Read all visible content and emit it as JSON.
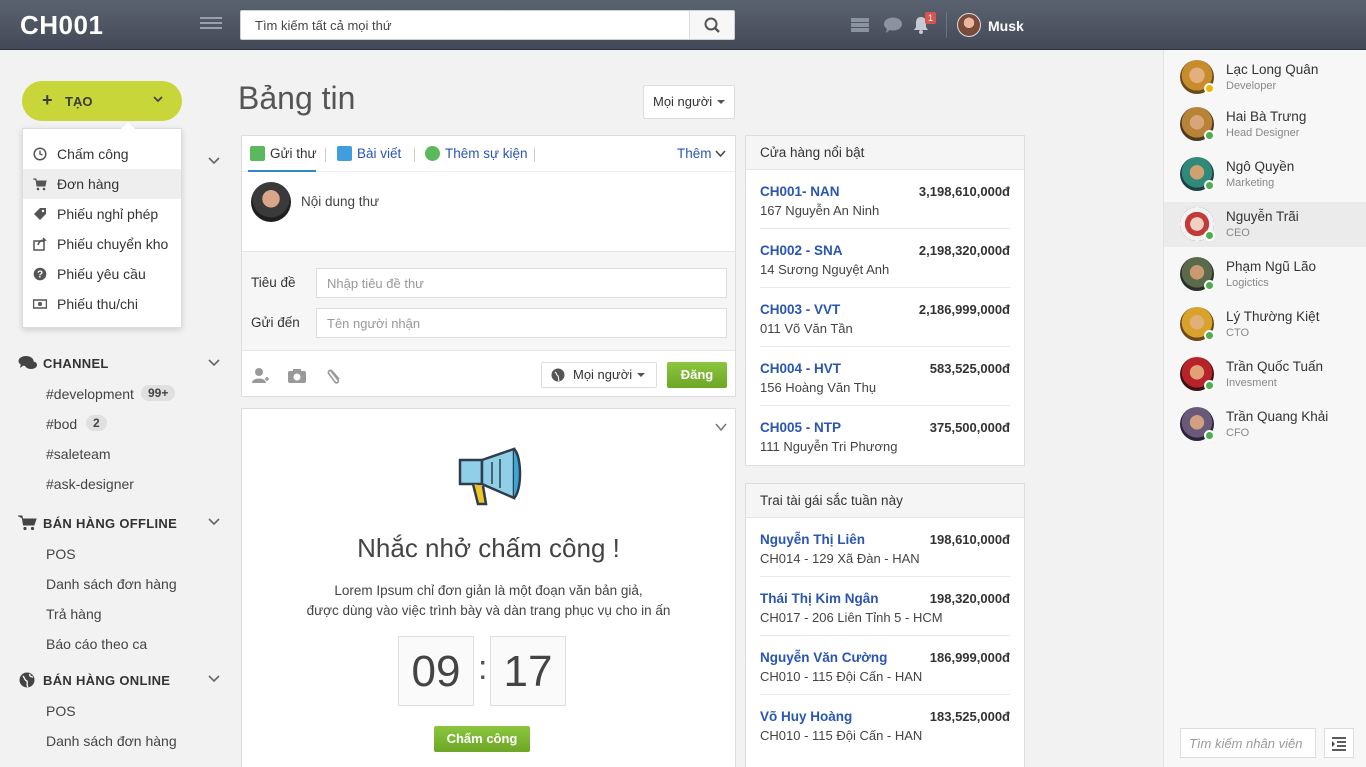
{
  "topbar": {
    "brand": "CH001",
    "search_placeholder": "Tìm kiếm tất cả mọi thứ",
    "notification_count": "1",
    "user_name": "Musk"
  },
  "left": {
    "create_label": "TẠO",
    "create_menu": [
      {
        "label": "Chấm công",
        "icon": "clock-icon"
      },
      {
        "label": "Đơn hàng",
        "icon": "cart-icon"
      },
      {
        "label": "Phiếu nghỉ phép",
        "icon": "tag-icon"
      },
      {
        "label": "Phiếu chuyển kho",
        "icon": "share-icon"
      },
      {
        "label": "Phiếu yêu cầu",
        "icon": "question-icon"
      },
      {
        "label": "Phiếu thu/chi",
        "icon": "money-icon"
      }
    ],
    "channel": {
      "title": "CHANNEL",
      "items": [
        {
          "label": "#development",
          "badge": "99+"
        },
        {
          "label": "#bod",
          "badge": "2"
        },
        {
          "label": "#saleteam"
        },
        {
          "label": "#ask-designer"
        }
      ]
    },
    "offline": {
      "title": "BÁN HÀNG OFFLINE",
      "items": [
        "POS",
        "Danh sách đơn hàng",
        "Trả hàng",
        "Báo cáo theo ca"
      ]
    },
    "online": {
      "title": "BÁN HÀNG ONLINE",
      "items": [
        "POS",
        "Danh sách đơn hàng"
      ]
    }
  },
  "main": {
    "title": "Bảng tin",
    "audience": "Mọi người",
    "composer": {
      "tabs": [
        "Gửi thư",
        "Bài viết",
        "Thêm sự kiện"
      ],
      "more": "Thêm",
      "content_placeholder": "Nội dung thư",
      "subject_label": "Tiêu đề",
      "subject_placeholder": "Nhập tiêu đề thư",
      "to_label": "Gửi đến",
      "to_placeholder": "Tên người nhận",
      "audience": "Mọi người",
      "post_label": "Đăng"
    },
    "reminder": {
      "title": "Nhắc nhở chấm công !",
      "desc_line1": "Lorem Ipsum chỉ đơn giản là một đoạn văn bản giả,",
      "desc_line2": "được dùng vào việc trình bày và dàn trang phục vụ cho in ấn",
      "hour": "09",
      "minute": "17",
      "button": "Chấm công"
    }
  },
  "stores": {
    "title": "Cửa hàng nổi bật",
    "rows": [
      {
        "name": "CH001- NAN",
        "address": "167 Nguyễn An Ninh",
        "value": "3,198,610,000đ"
      },
      {
        "name": "CH002 - SNA",
        "address": "14 Sương Nguyệt Anh",
        "value": "2,198,320,000đ"
      },
      {
        "name": "CH003 - VVT",
        "address": "011 Võ Văn Tần",
        "value": "2,186,999,000đ"
      },
      {
        "name": "CH004 - HVT",
        "address": "156 Hoàng Văn Thụ",
        "value": "583,525,000đ"
      },
      {
        "name": "CH005 - NTP",
        "address": "111 Nguyễn Tri Phương",
        "value": "375,500,000đ"
      }
    ]
  },
  "top_people": {
    "title": "Trai tài gái sắc tuần này",
    "rows": [
      {
        "name": "Nguyễn Thị Liên",
        "address": "CH014 - 129 Xã Đàn - HAN",
        "value": "198,610,000đ"
      },
      {
        "name": "Thái Thị Kim Ngân",
        "address": "CH017 - 206 Liên Tỉnh 5 - HCM",
        "value": "198,320,000đ"
      },
      {
        "name": "Nguyễn Văn Cường",
        "address": "CH010 - 115 Đội Cấn - HAN",
        "value": "186,999,000đ"
      },
      {
        "name": "Võ Huy Hoàng",
        "address": "CH010 - 115 Đội Cấn - HAN",
        "value": "183,525,000đ"
      }
    ]
  },
  "members": [
    {
      "name": "Lạc Long Quân",
      "role": "Developer",
      "status_color": "#f0b400"
    },
    {
      "name": "Hai Bà Trưng",
      "role": "Head Designer",
      "status_color": "#4cae4c"
    },
    {
      "name": "Ngô Quyền",
      "role": "Marketing",
      "status_color": "#4cae4c"
    },
    {
      "name": "Nguyễn Trãi",
      "role": "CEO",
      "status_color": "#4cae4c"
    },
    {
      "name": "Phạm Ngũ Lão",
      "role": "Logictics",
      "status_color": "#4cae4c"
    },
    {
      "name": "Lý Thường Kiệt",
      "role": "CTO",
      "status_color": "#4cae4c"
    },
    {
      "name": "Trần Quốc Tuấn",
      "role": "Invesment",
      "status_color": "#4cae4c"
    },
    {
      "name": "Trần Quang Khải",
      "role": "CFO",
      "status_color": "#4cae4c"
    }
  ],
  "member_search_placeholder": "Tìm kiếm nhân viên",
  "colors": {
    "topbar": "#4b515e",
    "create_button": "#c8d63a",
    "link": "#2a55b0",
    "primary_green": "#7cb82f"
  }
}
